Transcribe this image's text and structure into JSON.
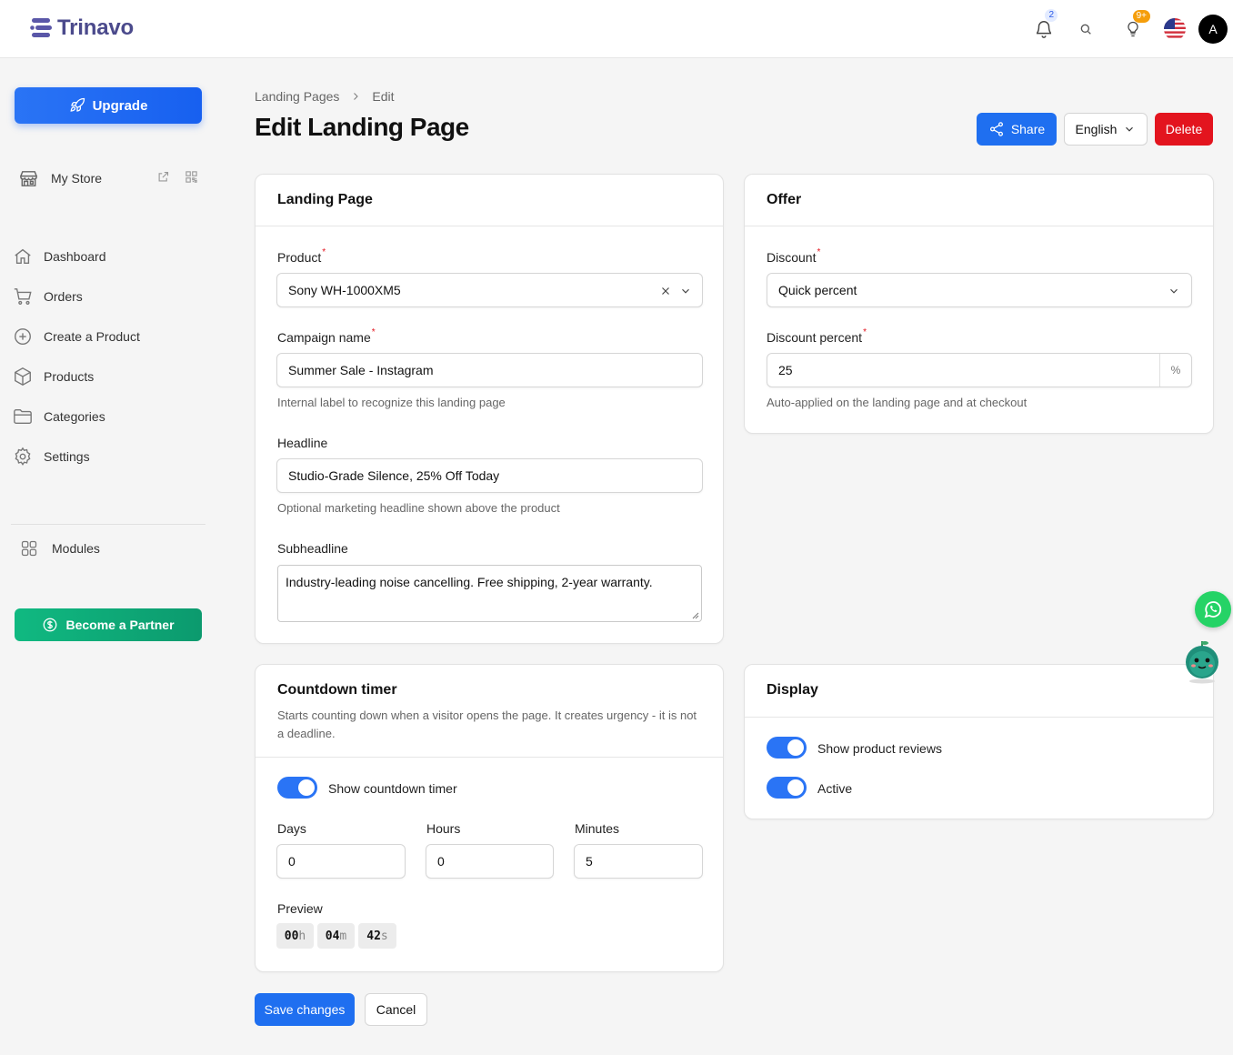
{
  "app": {
    "brand": "Trinavo"
  },
  "topbar": {
    "notifications_count": "2",
    "tips_count": "9+",
    "avatar_initial": "A"
  },
  "sidebar": {
    "upgrade_label": "Upgrade",
    "store_label": "My Store",
    "nav": [
      {
        "label": "Dashboard",
        "icon": "home-icon"
      },
      {
        "label": "Orders",
        "icon": "cart-icon"
      },
      {
        "label": "Create a Product",
        "icon": "plus-circle-icon"
      },
      {
        "label": "Products",
        "icon": "box-icon"
      },
      {
        "label": "Categories",
        "icon": "folder-icon"
      },
      {
        "label": "Settings",
        "icon": "gear-icon"
      }
    ],
    "modules_label": "Modules",
    "partner_label": "Become a Partner"
  },
  "header": {
    "breadcrumb": [
      "Landing Pages",
      "Edit"
    ],
    "title": "Edit Landing Page",
    "share_label": "Share",
    "language": "English",
    "delete_label": "Delete"
  },
  "landing_card": {
    "title": "Landing Page",
    "product_label": "Product",
    "product_value": "Sony WH-1000XM5",
    "campaign_label": "Campaign name",
    "campaign_value": "Summer Sale - Instagram",
    "campaign_help": "Internal label to recognize this landing page",
    "headline_label": "Headline",
    "headline_value": "Studio-Grade Silence, 25% Off Today",
    "headline_help": "Optional marketing headline shown above the product",
    "subheadline_label": "Subheadline",
    "subheadline_value": "Industry-leading noise cancelling. Free shipping, 2-year warranty."
  },
  "offer_card": {
    "title": "Offer",
    "discount_label": "Discount",
    "discount_value": "Quick percent",
    "percent_label": "Discount percent",
    "percent_value": "25",
    "percent_suffix": "%",
    "percent_help": "Auto-applied on the landing page and at checkout"
  },
  "countdown_card": {
    "title": "Countdown timer",
    "description": "Starts counting down when a visitor opens the page. It creates urgency - it is not a deadline.",
    "toggle_label": "Show countdown timer",
    "toggle_on": true,
    "days_label": "Days",
    "days_value": "0",
    "hours_label": "Hours",
    "hours_value": "0",
    "minutes_label": "Minutes",
    "minutes_value": "5",
    "preview_label": "Preview",
    "preview": [
      {
        "num": "00",
        "unit": "h"
      },
      {
        "num": "04",
        "unit": "m"
      },
      {
        "num": "42",
        "unit": "s"
      }
    ]
  },
  "display_card": {
    "title": "Display",
    "reviews_label": "Show product reviews",
    "reviews_on": true,
    "active_label": "Active",
    "active_on": true
  },
  "footer": {
    "save_label": "Save changes",
    "cancel_label": "Cancel"
  },
  "colors": {
    "primary": "#1f6ff0",
    "danger": "#e3141e",
    "partner": "#10b981",
    "brand": "#4b4a8c"
  }
}
